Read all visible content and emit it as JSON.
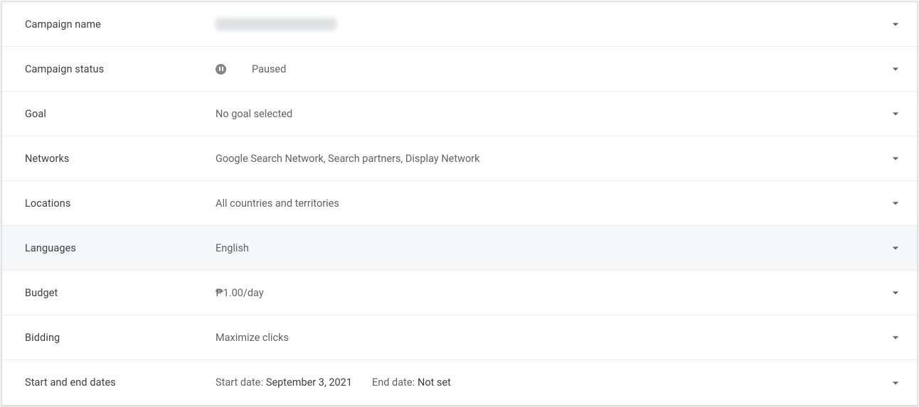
{
  "rows": {
    "campaign_name": {
      "label": "Campaign name"
    },
    "campaign_status": {
      "label": "Campaign status",
      "value": "Paused"
    },
    "goal": {
      "label": "Goal",
      "value": "No goal selected"
    },
    "networks": {
      "label": "Networks",
      "value": "Google Search Network, Search partners, Display Network"
    },
    "locations": {
      "label": "Locations",
      "value": "All countries and territories"
    },
    "languages": {
      "label": "Languages",
      "value": "English"
    },
    "budget": {
      "label": "Budget",
      "value": "₱1.00/day"
    },
    "bidding": {
      "label": "Bidding",
      "value": "Maximize clicks"
    },
    "dates": {
      "label": "Start and end dates",
      "start_label": "Start date:",
      "start_value": "September 3, 2021",
      "end_label": "End date:",
      "end_value": "Not set"
    }
  }
}
